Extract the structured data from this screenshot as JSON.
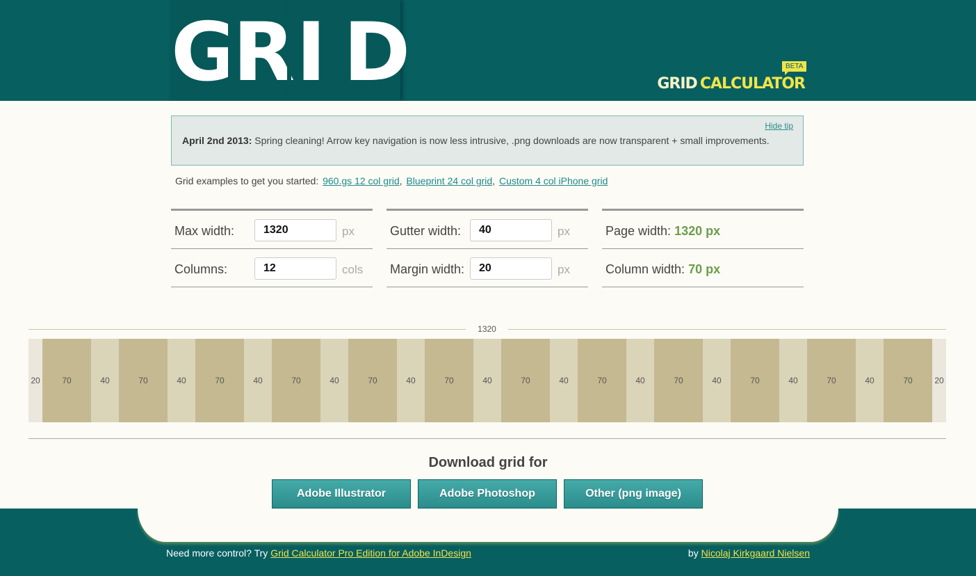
{
  "header": {
    "logo_letters": [
      "G",
      "R",
      "I",
      "D"
    ],
    "brand_part1": "GRID",
    "brand_part2": "CALCULATOR",
    "beta": "BETA"
  },
  "tip": {
    "hide_label": "Hide tip",
    "date": "April 2nd 2013:",
    "message": "Spring cleaning! Arrow key navigation is now less intrusive, .png downloads are now transparent + small improvements."
  },
  "examples": {
    "intro": "Grid examples to get you started:",
    "links": [
      "960.gs 12 col grid",
      "Blueprint 24 col grid",
      "Custom 4 col iPhone grid"
    ]
  },
  "form": {
    "max_width_label": "Max width:",
    "max_width_value": "1320",
    "max_width_unit": "px",
    "columns_label": "Columns:",
    "columns_value": "12",
    "columns_unit": "cols",
    "gutter_label": "Gutter width:",
    "gutter_value": "40",
    "gutter_unit": "px",
    "margin_label": "Margin width:",
    "margin_value": "20",
    "margin_unit": "px",
    "page_width_label": "Page width:",
    "page_width_value": "1320 px",
    "column_width_label": "Column width:",
    "column_width_value": "70 px"
  },
  "grid": {
    "total": "1320",
    "cells": [
      "20",
      "70",
      "40",
      "70",
      "40",
      "70",
      "40",
      "70",
      "40",
      "70",
      "40",
      "70",
      "40",
      "70",
      "40",
      "70",
      "40",
      "70",
      "40",
      "70",
      "40",
      "70",
      "40",
      "70",
      "20"
    ]
  },
  "download": {
    "title": "Download grid for",
    "buttons": [
      "Adobe Illustrator",
      "Adobe Photoshop",
      "Other (png image)"
    ]
  },
  "footer": {
    "left_text": "Need more control? Try",
    "left_link": "Grid Calculator Pro Edition for Adobe InDesign",
    "right_text": "by",
    "right_link": "Nicolaj Kirkgaard Nielsen"
  },
  "colors": {
    "header_bg": "#075f60",
    "accent_yellow": "#f0e44a",
    "value_green": "#6a9e4a",
    "column_fill": "#c5b991",
    "gutter_fill": "#dad4b9",
    "margin_fill": "#ebe7dc"
  }
}
